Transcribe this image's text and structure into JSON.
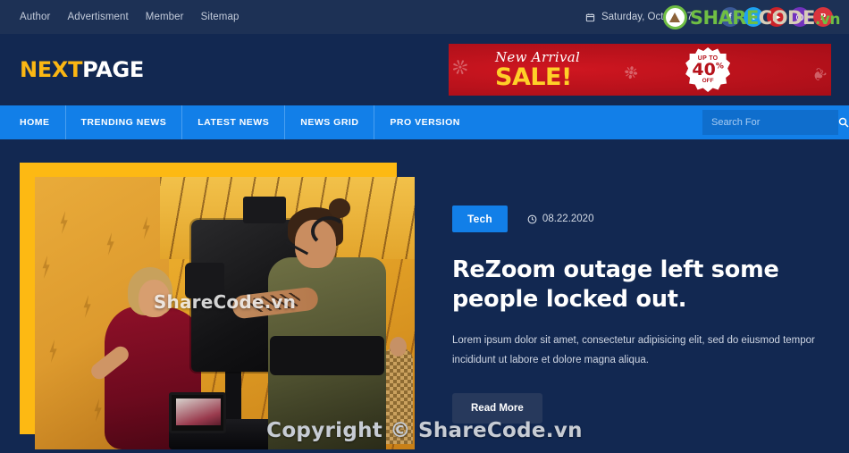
{
  "topbar": {
    "links": [
      {
        "label": "Author"
      },
      {
        "label": "Advertisment"
      },
      {
        "label": "Member"
      },
      {
        "label": "Sitemap"
      }
    ],
    "calendar_icon": "calendar-icon",
    "date": "Saturday, October 7",
    "socials": [
      {
        "name": "facebook",
        "glyph": "f",
        "color": "#3b5998"
      },
      {
        "name": "twitter",
        "glyph": "t",
        "color": "#1da1f2"
      },
      {
        "name": "youtube",
        "glyph": "▶",
        "color": "#cc2229"
      },
      {
        "name": "instagram",
        "glyph": "◎",
        "color": "#7232bd"
      },
      {
        "name": "pinterest",
        "glyph": "P",
        "color": "#d9343c"
      }
    ],
    "watermark": {
      "share": "SHARE",
      "code": "CODE",
      "vn": ".vn",
      "icon": "sharecode-leaf-icon"
    }
  },
  "header": {
    "logo": {
      "first": "NEXT",
      "second": "PAGE",
      "first_color": "#fbb713",
      "second_color": "#ffffff"
    },
    "ad": {
      "headline": "New Arrival",
      "title": "SALE!",
      "badge_top": "UP TO",
      "badge_num": "40",
      "badge_pct": "%",
      "badge_off": "OFF",
      "bg_color": "#c0121b",
      "title_color": "#ffd028"
    }
  },
  "nav": {
    "items": [
      {
        "label": "HOME"
      },
      {
        "label": "TRENDING NEWS"
      },
      {
        "label": "LATEST NEWS"
      },
      {
        "label": "NEWS GRID"
      },
      {
        "label": "PRO VERSION"
      }
    ],
    "accent_color": "#127fe8",
    "search": {
      "placeholder": "Search For",
      "value": "",
      "icon": "search-icon"
    }
  },
  "hero": {
    "image_alt": "film-set-camera-operator-and-model",
    "frame_color": "#fdb913",
    "watermark": "ShareCode.vn"
  },
  "article": {
    "category": "Tech",
    "category_color": "#127fe8",
    "clock_icon": "clock-icon",
    "date": "08.22.2020",
    "headline": "ReZoom outage left some people locked out.",
    "excerpt": "Lorem ipsum dolor sit amet, consectetur adipisicing elit, sed do eiusmod tempor incididunt ut labore et dolore magna aliqua.",
    "read_more": "Read More"
  },
  "page_watermark": "Copyright © ShareCode.vn",
  "theme": {
    "background": "#122851",
    "topbar_background": "#1d3155",
    "accent": "#127fe8",
    "yellow": "#fdb913"
  }
}
